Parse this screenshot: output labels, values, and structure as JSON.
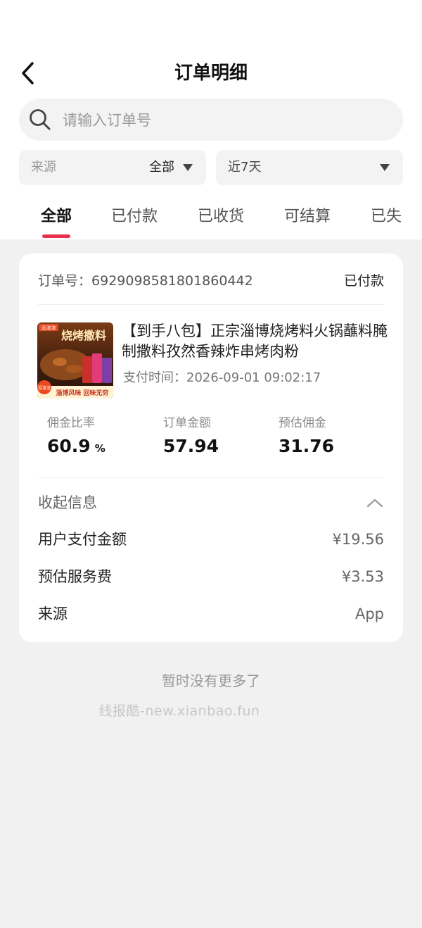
{
  "header": {
    "title": "订单明细"
  },
  "search": {
    "placeholder": "请输入订单号"
  },
  "filters": {
    "source_label": "来源",
    "source_value": "全部",
    "date_value": "近7天"
  },
  "tabs": [
    {
      "label": "全部",
      "active": true
    },
    {
      "label": "已付款"
    },
    {
      "label": "已收货"
    },
    {
      "label": "可结算"
    },
    {
      "label": "已失"
    }
  ],
  "order": {
    "order_no_label": "订单号：",
    "order_no": "6929098581801860442",
    "status": "已付款",
    "product_title": "【到手八包】正宗淄博烧烤料火锅蘸料腌制撒料孜然香辣炸串烤肉粉",
    "pay_time_label": "支付时间：",
    "pay_time": "2026-09-01 09:02:17",
    "image": {
      "brand": "没渣渣",
      "headline": "烧烤撒料",
      "badge_left": "没渣渣",
      "slogan": "淄博风味 回味无穷"
    },
    "stats": [
      {
        "label": "佣金比率",
        "value": "60.9",
        "unit": "%"
      },
      {
        "label": "订单金额",
        "value": "57.94"
      },
      {
        "label": "预估佣金",
        "value": "31.76"
      }
    ],
    "collapse_label": "收起信息",
    "details": [
      {
        "label": "用户支付金额",
        "value": "¥19.56"
      },
      {
        "label": "预估服务费",
        "value": "¥3.53"
      },
      {
        "label": "来源",
        "value": "App"
      }
    ]
  },
  "footer": {
    "no_more": "暂时没有更多了",
    "watermark": "线报酷-new.xianbao.fun"
  },
  "colors": {
    "accent": "#e8304c",
    "background": "#f1f1f1",
    "card": "#ffffff"
  }
}
